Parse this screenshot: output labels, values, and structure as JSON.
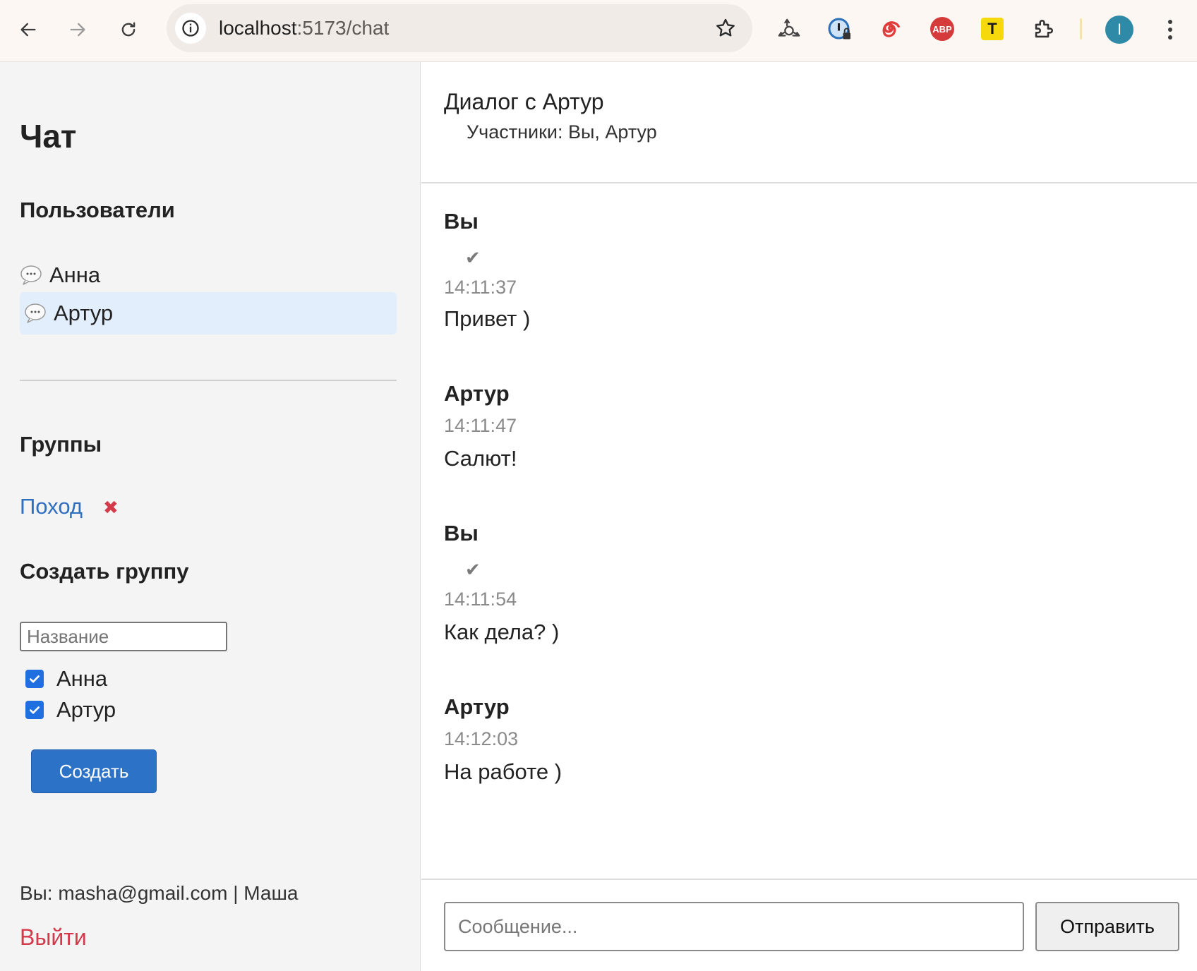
{
  "browser": {
    "url_host": "localhost",
    "url_path": ":5173/chat",
    "profile_initial": "I",
    "extensions": {
      "abp_label": "ABP",
      "t_label": "T"
    }
  },
  "sidebar": {
    "title": "Чат",
    "users_heading": "Пользователи",
    "users": [
      {
        "name": "Анна",
        "active": false
      },
      {
        "name": "Артур",
        "active": true
      }
    ],
    "groups_heading": "Группы",
    "groups": [
      {
        "name": "Поход",
        "delete_icon": "✖"
      }
    ],
    "create_group": {
      "heading": "Создать группу",
      "name_placeholder": "Название",
      "members": [
        {
          "name": "Анна",
          "checked": true
        },
        {
          "name": "Артур",
          "checked": true
        }
      ],
      "submit_label": "Создать"
    },
    "current_user": "Вы: masha@gmail.com | Маша",
    "logout_label": "Выйти"
  },
  "dialog": {
    "title": "Диалог с Артур",
    "members": "Участники: Вы, Артур",
    "messages": [
      {
        "author": "Вы",
        "read_mark": "✔",
        "time": "14:11:37",
        "text": "Привет )"
      },
      {
        "author": "Артур",
        "time": "14:11:47",
        "text": "Салют!"
      },
      {
        "author": "Вы",
        "read_mark": "✔",
        "time": "14:11:54",
        "text": "Как дела? )"
      },
      {
        "author": "Артур",
        "time": "14:12:03",
        "text": "На работе )"
      }
    ],
    "composer": {
      "placeholder": "Сообщение...",
      "send_label": "Отправить"
    }
  },
  "colors": {
    "accent_blue": "#2c72c7",
    "link_blue": "#2f6fbf",
    "danger_red": "#d33a4a",
    "active_user_bg": "#e2eefb"
  }
}
